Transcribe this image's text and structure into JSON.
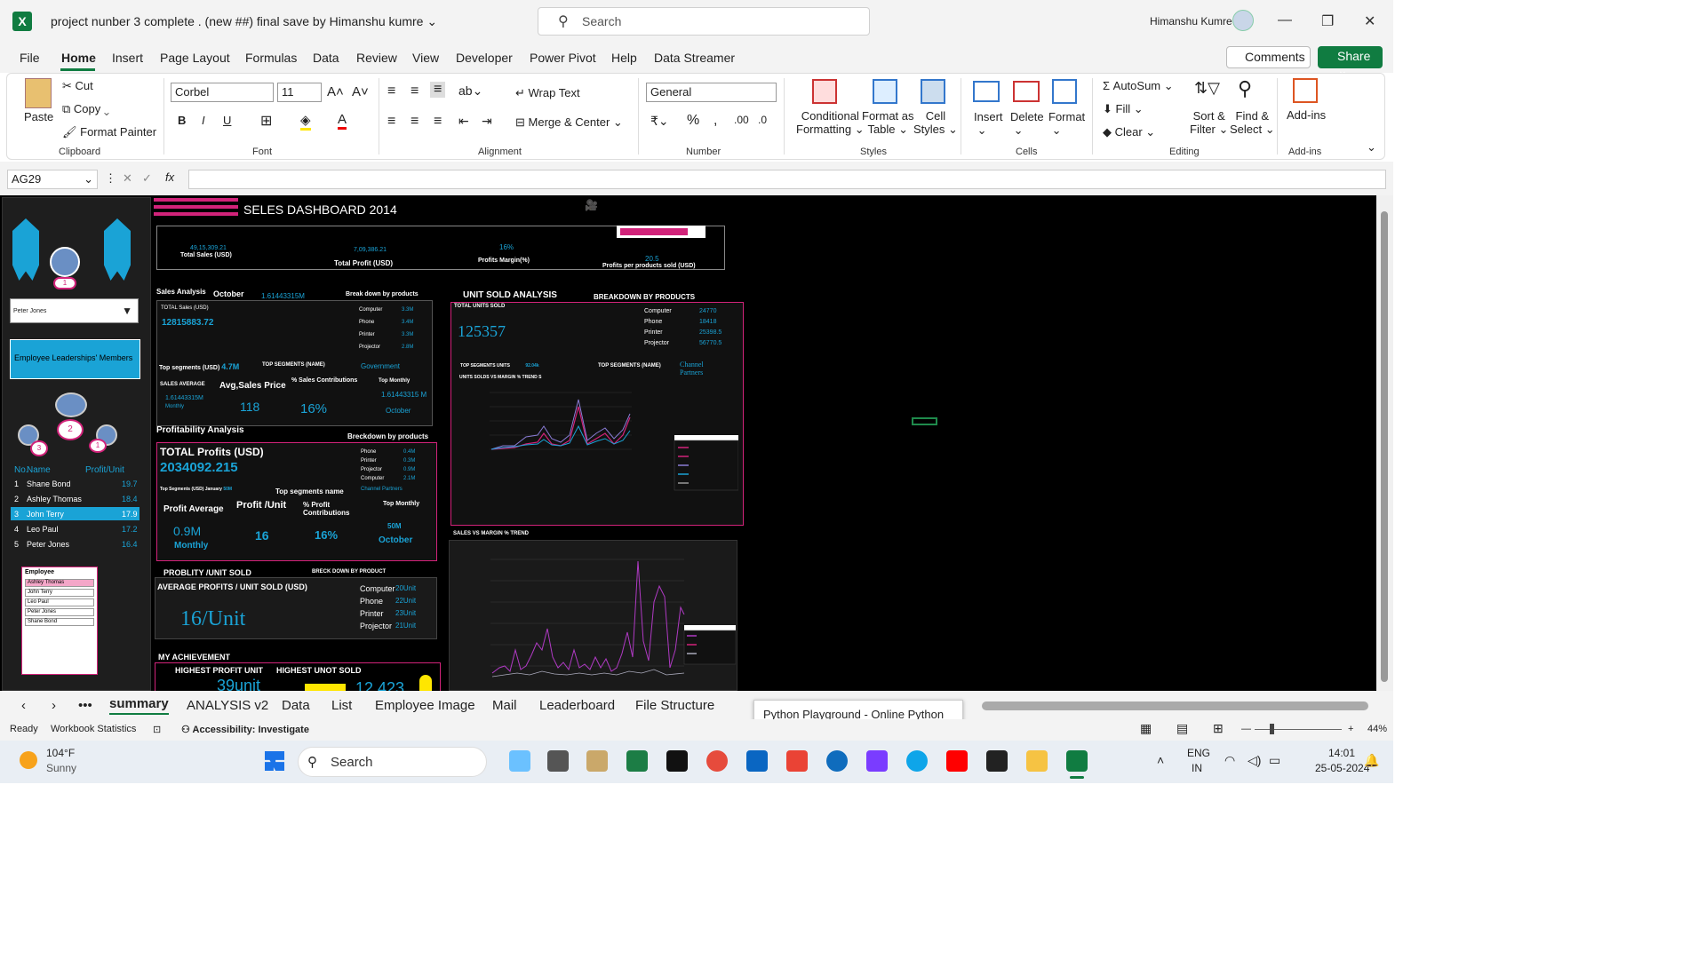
{
  "app": {
    "title": "project nunber 3 complete . (new ##) final save by Himanshu kumre",
    "search_placeholder": "Search",
    "user": "Himanshu Kumre"
  },
  "menu": [
    "File",
    "Home",
    "Insert",
    "Page Layout",
    "Formulas",
    "Data",
    "Review",
    "View",
    "Developer",
    "Power Pivot",
    "Help",
    "Data Streamer"
  ],
  "buttons": {
    "comments": "Comments",
    "share": "Share"
  },
  "ribbon": {
    "clipboard": {
      "paste": "Paste",
      "cut": "Cut",
      "copy": "Copy",
      "format_painter": "Format Painter",
      "label": "Clipboard"
    },
    "font": {
      "name": "Corbel",
      "size": "11",
      "label": "Font"
    },
    "alignment": {
      "wrap": "Wrap Text",
      "merge": "Merge & Center",
      "label": "Alignment"
    },
    "number": {
      "format": "General",
      "label": "Number"
    },
    "styles": {
      "cond": "Conditional",
      "cond2": "Formatting",
      "fmt_table": "Format as",
      "fmt_table2": "Table",
      "cell": "Cell",
      "cell2": "Styles",
      "label": "Styles"
    },
    "cells": {
      "insert": "Insert",
      "delete": "Delete",
      "format": "Format",
      "label": "Cells"
    },
    "editing": {
      "autosum": "AutoSum",
      "fill": "Fill",
      "clear": "Clear",
      "sort": "Sort &",
      "sort2": "Filter",
      "find": "Find &",
      "find2": "Select",
      "label": "Editing"
    },
    "addins": {
      "addins": "Add-ins",
      "label": "Add-ins"
    }
  },
  "namebox": "AG29",
  "dash": {
    "title": "SELES DASHBOARD  2014",
    "kpi": [
      {
        "v": "49,15,309.21",
        "l": "Total Sales (USD)"
      },
      {
        "v": "7,09,386.21",
        "l": "Total Profit (USD)"
      },
      {
        "v": "16%",
        "l": "Profits Margin(%)"
      },
      {
        "v": "20.5",
        "l": "Profits per products sold (USD)"
      }
    ],
    "sales": {
      "head": "Sales Analysis",
      "month": "October",
      "val": "1.61443315M",
      "breakdown": "Break down by products",
      "total_lbl": "TOTAL Sales (USD)",
      "total": "12815883.72",
      "products": [
        "Computer",
        "Phone",
        "Printer",
        "Projector"
      ],
      "pvals": [
        "3.3M",
        "3.4M",
        "3.3M",
        "2.8M"
      ],
      "seg_lbl": "Top segments (USD)",
      "seg_val": "4.7M",
      "seg_name_lbl": "TOP SEGMENTS (NAME)",
      "seg_name": "Government",
      "avg_lbl": "SALES AVERAGE",
      "avg_val": "1.61443315M",
      "avg_sub": "Monthly",
      "asp_lbl": "Avg,Sales Price",
      "asp": "118",
      "contrib_lbl": "% Sales Contributions",
      "contrib": "16%",
      "top_lbl": "Top Monthly",
      "top_val": "1.61443315 M",
      "top_m": "October"
    },
    "profit": {
      "head": "Profitability Analysis",
      "breakdown": "Breckdown by products",
      "total_lbl": "TOTAL  Profits (USD)",
      "total": "2034092.215",
      "products": [
        "Phone",
        "Printer",
        "Projector",
        "Computer"
      ],
      "pvals": [
        "0.4M",
        "0.3M",
        "0.9M",
        "2.1M"
      ],
      "seg": "Top Segments (USD)",
      "seg_m": "January",
      "seg_v": "50M",
      "seg_name_lbl": "Top segments  name",
      "seg_name": "Channel Partners",
      "avg_lbl": "Profit Average",
      "avg": "0.9M",
      "avg_sub": "Monthly",
      "unit_lbl": "Profit /Unit",
      "unit": "16",
      "pct_lbl": "% Profit Contributions",
      "pct": "16%",
      "top_lbl": "Top Monthly",
      "top_v": "50M",
      "top_m": "October"
    },
    "probl": {
      "head": "PROBLITY /UNIT SOLD",
      "breck": "BRECK DOWN BY PRODUCT",
      "avg_lbl": "AVERAGE  PROFITS / UNIT SOLD (USD)",
      "avg": "16/Unit",
      "products": [
        "Computer",
        "Phone",
        "Printer",
        "Projector"
      ],
      "pvals": [
        "20Unit",
        "22Unit",
        "23Unit",
        "21Unit"
      ]
    },
    "ach": {
      "head": "MY ACHIEVEMENT",
      "l1": "HIGHEST PROFIT UNIT",
      "l2": "HIGHEST UNOT SOLD",
      "v1": "39unit",
      "v2": "12,423"
    },
    "units": {
      "head": "UNIT SOLD ANALYSIS",
      "breakdown": "BREAKDOWN BY PRODUCTS",
      "total_lbl": "TOTAL  UNITS SOLD",
      "total": "125357",
      "products": [
        "Computer",
        "Phone",
        "Printer",
        "Projector"
      ],
      "pvals": [
        "24770",
        "18418",
        "25398.5",
        "56770.5"
      ],
      "seg_lbl": "TOP SEGMENTS UNITS",
      "seg_v": "92.04k",
      "seg_name_lbl": "TOP SEGMENTS  (NAME)",
      "seg_name": "Channel Partners",
      "chart_title": "UNITS SOLDS VS MARGIN % TREND S"
    },
    "trend": {
      "head": "SALES  VS MARGIN % TREND"
    },
    "left": {
      "dropdown": "Peter Jones",
      "members": "Employee Leaderships' Members",
      "table_h": [
        "No.",
        "Name",
        "Profit/Unit"
      ],
      "rows": [
        [
          "1",
          "Shane Bond",
          "19.7"
        ],
        [
          "2",
          "Ashley Thomas",
          "18.4"
        ],
        [
          "3",
          "John Terry",
          "17.9"
        ],
        [
          "4",
          "Leo Paul",
          "17.2"
        ],
        [
          "5",
          "Peter Jones",
          "16.4"
        ]
      ],
      "slicer_title": "Employee",
      "slicer": [
        "Ashley Thomas",
        "John Terry",
        "Leo Paul",
        "Peter Jones",
        "Shane Bond"
      ]
    }
  },
  "sheets": [
    "summary",
    "ANALYSIS v2",
    "Data",
    "List",
    "Employee Image",
    "Mail",
    "Leaderboard",
    "File Structure"
  ],
  "tooltip": "Python Playground - Online Python IDE",
  "status": {
    "ready": "Ready",
    "stats": "Workbook Statistics",
    "access": "Accessibility: Investigate",
    "zoom": "44%"
  },
  "taskbar": {
    "temp": "104°F",
    "weather": "Sunny",
    "search": "Search",
    "lang1": "ENG",
    "lang2": "IN",
    "time": "14:01",
    "date": "25-05-2024"
  },
  "colors": {
    "excel_green": "#107c41",
    "pink": "#d2237a",
    "cyan": "#1aa3d6"
  }
}
